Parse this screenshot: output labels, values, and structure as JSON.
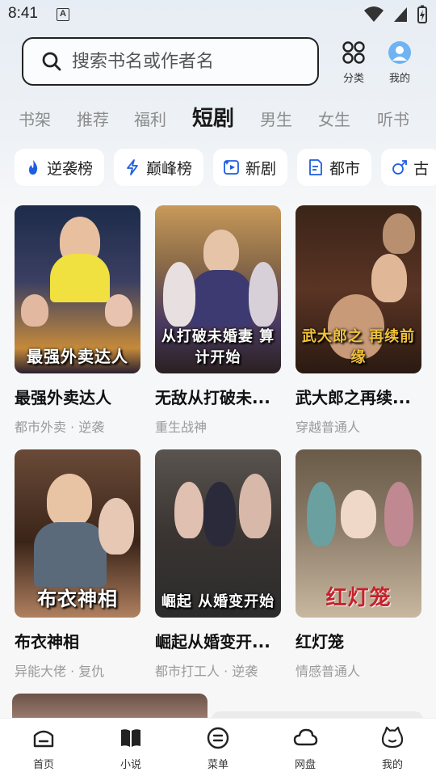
{
  "status": {
    "time": "8:41",
    "a_badge": "A"
  },
  "search": {
    "placeholder": "搜索书名或作者名"
  },
  "top_buttons": {
    "category": "分类",
    "mine": "我的"
  },
  "tabs": [
    {
      "label": "书架"
    },
    {
      "label": "推荐"
    },
    {
      "label": "福利"
    },
    {
      "label": "短剧",
      "active": true
    },
    {
      "label": "男生"
    },
    {
      "label": "女生"
    },
    {
      "label": "听书"
    }
  ],
  "chips": [
    {
      "label": "逆袭榜",
      "icon": "fire-icon"
    },
    {
      "label": "巅峰榜",
      "icon": "lightning-icon"
    },
    {
      "label": "新剧",
      "icon": "sparkle-play-icon"
    },
    {
      "label": "都市",
      "icon": "document-icon"
    },
    {
      "label": "古",
      "icon": "male-symbol-icon"
    }
  ],
  "dramas": [
    {
      "title": "最强外卖达人",
      "tags": "都市外卖 · 逆袭",
      "poster_text": "最强外卖达人",
      "colors": [
        "#1d2b4a",
        "#c58a3a"
      ]
    },
    {
      "title": "无敌从打破未...",
      "tags": "重生战神",
      "poster_text": "从打破未婚妻 算计开始",
      "colors": [
        "#6b4a2a",
        "#e0c48a"
      ]
    },
    {
      "title": "武大郎之再续...",
      "tags": "穿越普通人",
      "poster_text": "武大郎之 再续前缘",
      "colors": [
        "#2a1a12",
        "#7a3a22"
      ]
    },
    {
      "title": "布衣神相",
      "tags": "异能大佬 · 复仇",
      "poster_text": "布衣神相",
      "colors": [
        "#3a2418",
        "#b08060"
      ]
    },
    {
      "title": "崛起从婚变开...",
      "tags": "都市打工人 · 逆袭",
      "poster_text": "崛起 从婚变开始",
      "colors": [
        "#2c2c2c",
        "#8a7a70"
      ]
    },
    {
      "title": "红灯笼",
      "tags": "情感普通人",
      "poster_text": "红灯笼",
      "colors": [
        "#4a4038",
        "#c8b8a0"
      ]
    }
  ],
  "bottom_nav": [
    {
      "label": "首页",
      "icon": "home-icon"
    },
    {
      "label": "小说",
      "icon": "book-icon"
    },
    {
      "label": "菜单",
      "icon": "menu-icon"
    },
    {
      "label": "网盘",
      "icon": "cloud-icon"
    },
    {
      "label": "我的",
      "icon": "face-icon"
    }
  ]
}
